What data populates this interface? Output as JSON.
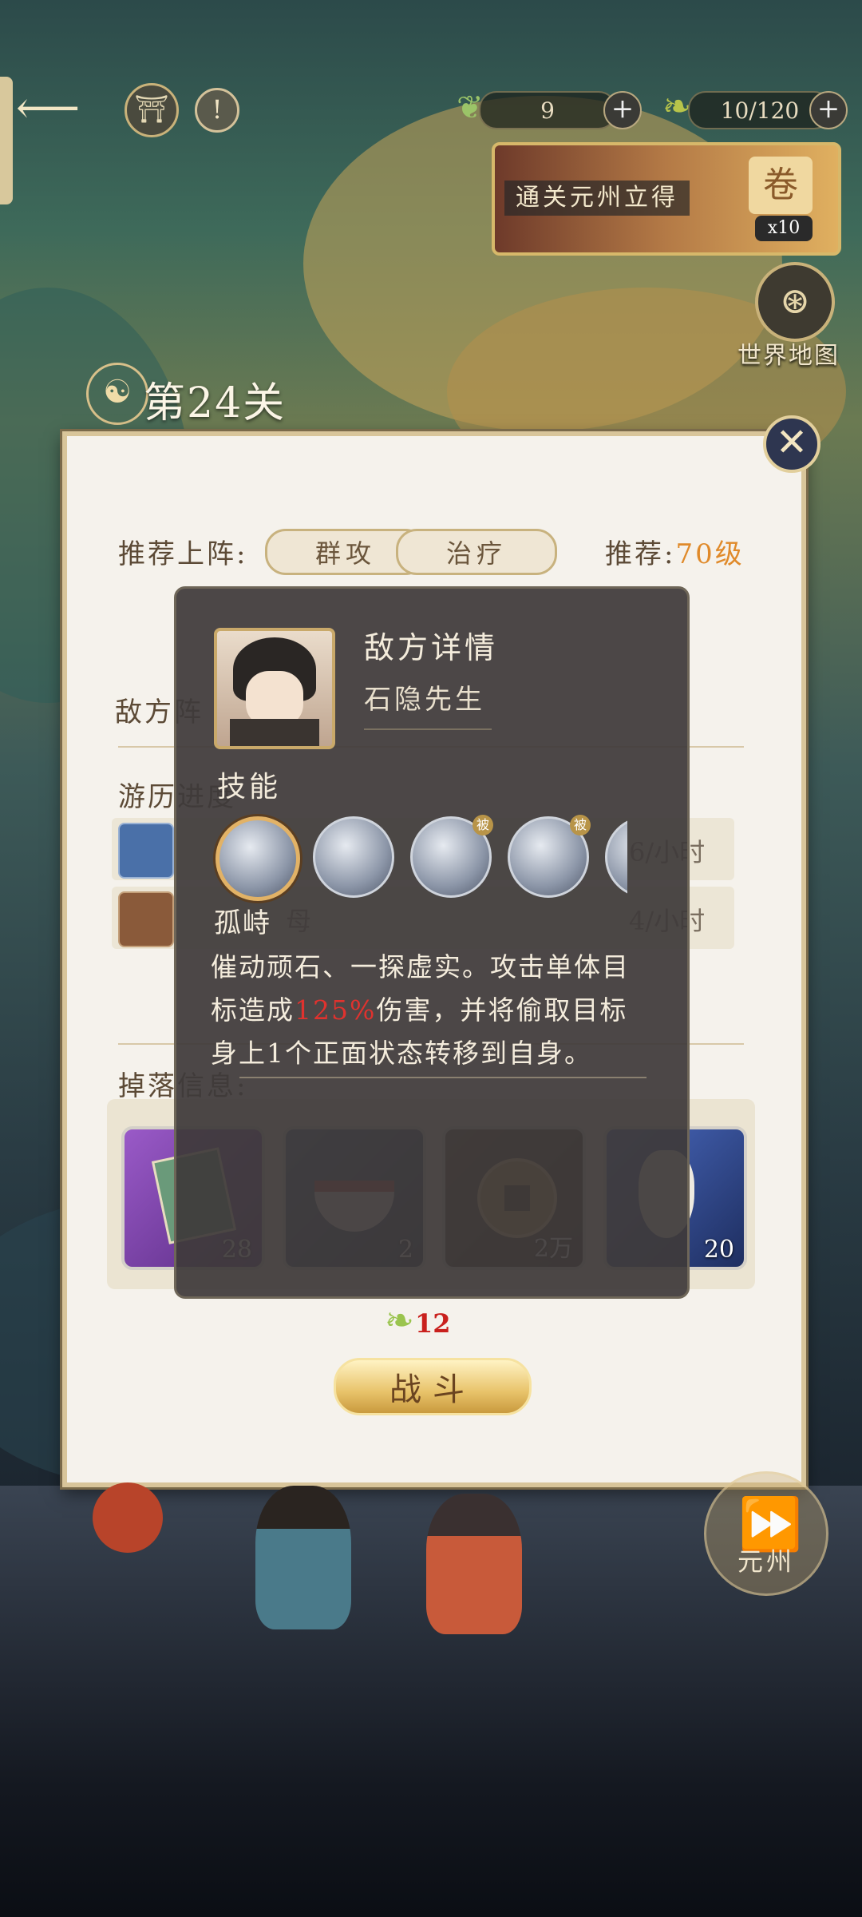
{
  "hud": {
    "stamina_value": "9",
    "leaf_value": "10/120",
    "quest_banner": "通关元州立得",
    "quest_reward_count": "x10",
    "world_map_label": "世界地图"
  },
  "stage": {
    "title": "第24关"
  },
  "panel": {
    "recommend_label": "推荐上阵:",
    "tags": [
      "群攻",
      "治疗"
    ],
    "recommend_level_label": "推荐:",
    "recommend_level_value": "70级",
    "enemy_label": "敌方阵",
    "progress_label": "游历进度",
    "progress_rows": [
      {
        "text": "",
        "rate": "6/小时"
      },
      {
        "text": "母",
        "rate": "4/小时"
      }
    ],
    "drops_label": "掉落信息:",
    "drops": [
      {
        "name": "book-item",
        "count": "28",
        "color": "#8a4fb8"
      },
      {
        "name": "bowl-item",
        "count": "2",
        "color": "#3d5478"
      },
      {
        "name": "coin-item",
        "count": "2万",
        "color": "#4a3a2a"
      },
      {
        "name": "gourd-item",
        "count": "20",
        "color": "#3d5aa6"
      }
    ],
    "battle_cost": "12",
    "battle_label": "战斗"
  },
  "enemy_detail": {
    "title": "敌方详情",
    "name": "石隐先生",
    "skills_heading": "技能",
    "skills": [
      {
        "icon": "swirl-skill-icon",
        "badge": ""
      },
      {
        "icon": "spirit-skill-icon",
        "badge": ""
      },
      {
        "icon": "chain-skill-icon",
        "badge": "被"
      },
      {
        "icon": "shield-skill-icon",
        "badge": "被"
      },
      {
        "icon": "partial-skill-icon",
        "badge": ""
      }
    ],
    "selected_skill_name": "孤峙",
    "desc_part1": "催动顽石、一探虚实。攻击单体目标造成",
    "desc_highlight": "125%",
    "desc_part2": "伤害，并将偷取目标身上1个正面状态转移到自身。"
  },
  "nav": {
    "next_region_label": "元州"
  }
}
